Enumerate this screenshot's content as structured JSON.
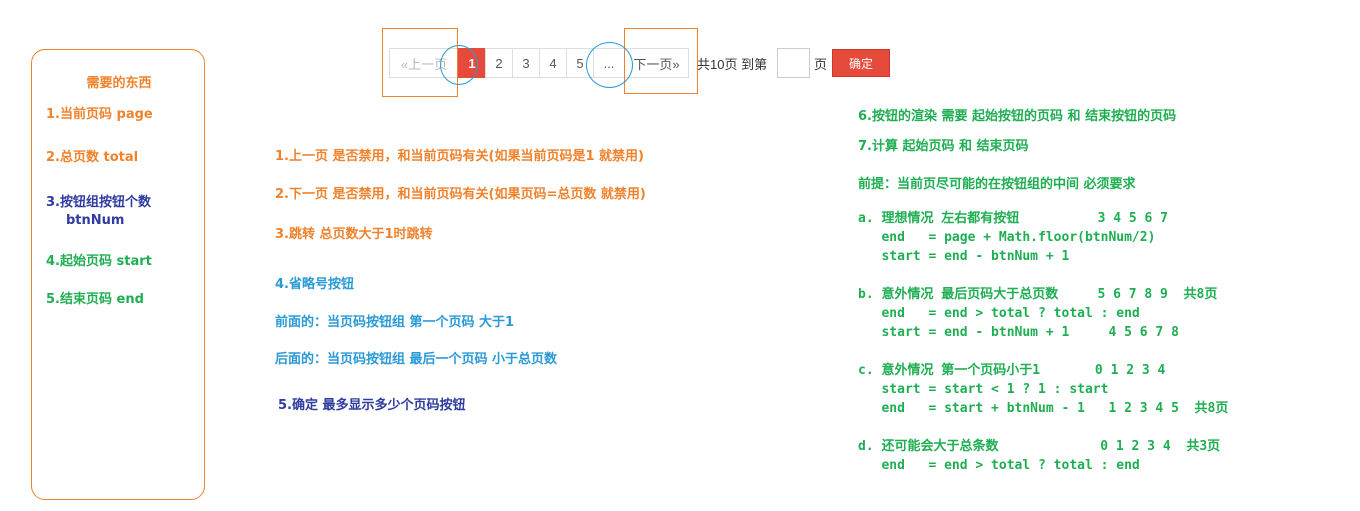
{
  "left_panel": {
    "title": "需要的东西",
    "items": [
      "1.当前页码 page",
      "2.总页数 total",
      "3.按钮组按钮个数",
      "btnNum",
      "4.起始页码 start",
      "5.结束页码 end"
    ]
  },
  "pagination": {
    "prev_label": "«上一页",
    "pages": [
      "1",
      "2",
      "3",
      "4",
      "5"
    ],
    "active_page": "1",
    "ellipsis": "...",
    "next_label": "下一页»",
    "total_text": "共10页 到第",
    "jump_value": "",
    "unit_text": "页",
    "confirm_label": "确定"
  },
  "middle_notes": {
    "n1": "1.上一页 是否禁用，和当前页码有关(如果当前页码是1 就禁用)",
    "n2": "2.下一页 是否禁用，和当前页码有关(如果页码=总页数 就禁用)",
    "n3": "3.跳转 总页数大于1时跳转",
    "n4": "4.省略号按钮",
    "n4a": "前面的：当页码按钮组 第一个页码 大于1",
    "n4b": "后面的：当页码按钮组 最后一个页码 小于总页数",
    "n5": "5.确定 最多显示多少个页码按钮"
  },
  "right_notes": {
    "n6": "6.按钮的渲染 需要 起始按钮的页码 和 结束按钮的页码",
    "n7": "7.计算 起始页码 和 结束页码",
    "premise": "前提：当前页尽可能的在按钮组的中间 必须要求",
    "a": {
      "line1": "a. 理想情况 左右都有按钮          3 4 5 6 7",
      "line2": "   end   = page + Math.floor(btnNum/2)",
      "line3": "   start = end - btnNum + 1"
    },
    "b": {
      "line1": "b. 意外情况 最后页码大于总页数     5 6 7 8 9  共8页",
      "line2": "   end   = end > total ? total : end",
      "line3": "   start = end - btnNum + 1     4 5 6 7 8"
    },
    "c": {
      "line1": "c. 意外情况 第一个页码小于1       0 1 2 3 4",
      "line2": "   start = start < 1 ? 1 : start",
      "line3": "   end   = start + btnNum - 1   1 2 3 4 5  共8页"
    },
    "d": {
      "line1": "d. 还可能会大于总条数             0 1 2 3 4  共3页",
      "line2": "   end   = end > total ? total : end"
    }
  },
  "colors": {
    "orange": "#f0822d",
    "green": "#1fae52",
    "blue": "#2a9ad6",
    "navy": "#2e3ca0",
    "active_red": "#e64a3b"
  }
}
